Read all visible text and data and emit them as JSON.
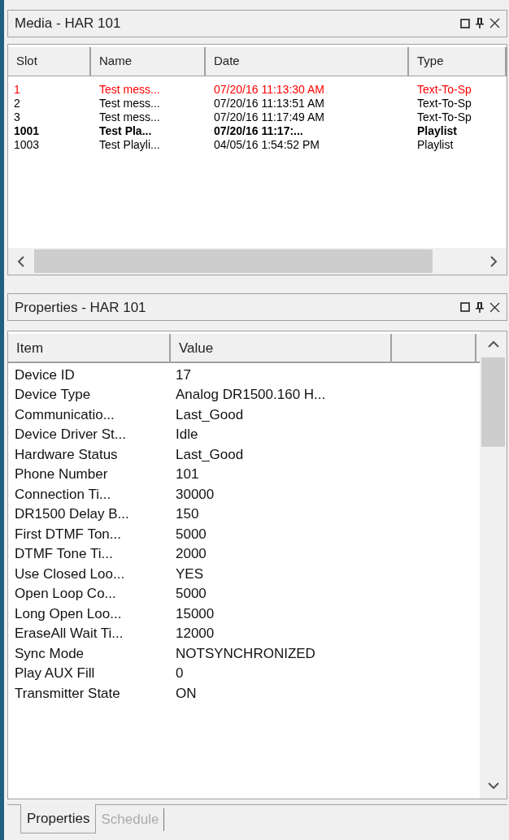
{
  "media_panel": {
    "title": "Media - HAR 101",
    "columns": [
      "Slot",
      "Name",
      "Date",
      "Type"
    ],
    "rows": [
      {
        "slot": "1",
        "name": "Test mess...",
        "date": "07/20/16 11:13:30 AM",
        "type": "Text-To-Sp",
        "color": "#ff0000",
        "bold": false
      },
      {
        "slot": "2",
        "name": "Test mess...",
        "date": "07/20/16 11:13:51 AM",
        "type": "Text-To-Sp",
        "color": "#000000",
        "bold": false
      },
      {
        "slot": "3",
        "name": "Test mess...",
        "date": "07/20/16 11:17:49 AM",
        "type": "Text-To-Sp",
        "color": "#000000",
        "bold": false
      },
      {
        "slot": "1001",
        "name": "Test Pla...",
        "date": "07/20/16 11:17:...",
        "type": "Playlist",
        "color": "#000000",
        "bold": true
      },
      {
        "slot": "1003",
        "name": "Test Playli...",
        "date": "04/05/16 1:54:52 PM",
        "type": "Playlist",
        "color": "#000000",
        "bold": false
      }
    ]
  },
  "properties_panel": {
    "title": "Properties - HAR 101",
    "columns": [
      "Item",
      "Value"
    ],
    "rows": [
      {
        "item": "Device ID",
        "value": "17"
      },
      {
        "item": "Device Type",
        "value": "Analog DR1500.160 H..."
      },
      {
        "item": "Communicatio...",
        "value": "Last_Good"
      },
      {
        "item": "Device Driver St...",
        "value": "Idle"
      },
      {
        "item": "Hardware Status",
        "value": "Last_Good"
      },
      {
        "item": "Phone Number",
        "value": "101"
      },
      {
        "item": "Connection Ti...",
        "value": "30000"
      },
      {
        "item": "DR1500 Delay B...",
        "value": "150"
      },
      {
        "item": "First DTMF Ton...",
        "value": "5000"
      },
      {
        "item": "DTMF Tone Ti...",
        "value": "2000"
      },
      {
        "item": "Use Closed Loo...",
        "value": "YES"
      },
      {
        "item": "Open Loop Co...",
        "value": "5000"
      },
      {
        "item": "Long Open Loo...",
        "value": "15000"
      },
      {
        "item": "EraseAll Wait Ti...",
        "value": "12000"
      },
      {
        "item": "Sync Mode",
        "value": "NOTSYNCHRONIZED"
      },
      {
        "item": "Play AUX Fill",
        "value": "0"
      },
      {
        "item": "Transmitter State",
        "value": "ON"
      }
    ]
  },
  "tabs": [
    {
      "label": "Properties",
      "selected": true
    },
    {
      "label": "Schedule",
      "selected": false
    }
  ]
}
